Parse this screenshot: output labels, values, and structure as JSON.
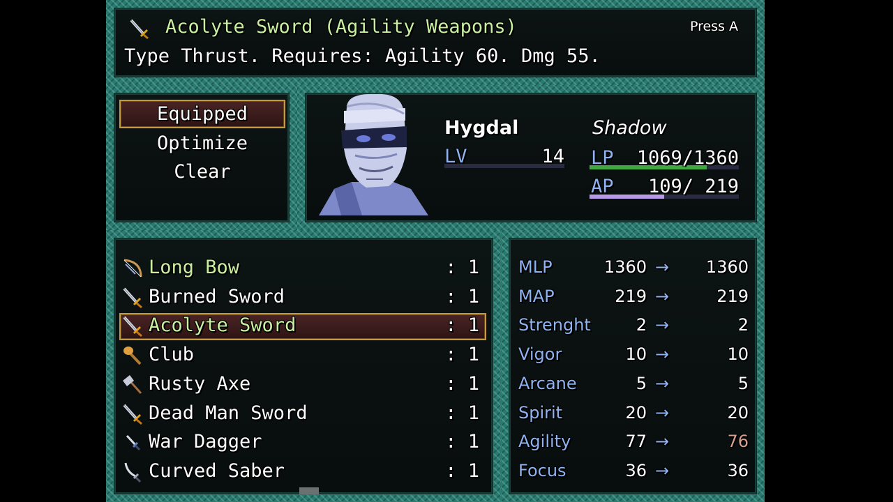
{
  "help": {
    "item_name": "Acolyte Sword (Agility Weapons)",
    "description": "Type Thrust. Requires: Agility 60. Dmg 55.",
    "press_hint": "Press A",
    "icon": "sword-icon"
  },
  "command_menu": {
    "items": [
      {
        "label": "Equipped",
        "selected": true
      },
      {
        "label": "Optimize",
        "selected": false
      },
      {
        "label": "Clear",
        "selected": false
      }
    ]
  },
  "actor": {
    "name": "Hygdal",
    "class": "Shadow",
    "level_label": "LV",
    "level": "14",
    "lp_label": "LP",
    "lp": "1069/1360",
    "lp_current": 1069,
    "lp_max": 1360,
    "ap_label": "AP",
    "ap": "109/ 219",
    "ap_current": 109,
    "ap_max": 219,
    "portrait": "bandaged-face-portrait"
  },
  "items": [
    {
      "name": "Long Bow",
      "count": ": 1",
      "icon": "bow-icon",
      "highlight": true,
      "selected": false
    },
    {
      "name": "Burned Sword",
      "count": ": 1",
      "icon": "sword-icon",
      "highlight": false,
      "selected": false
    },
    {
      "name": "Acolyte Sword",
      "count": ": 1",
      "icon": "sword-icon",
      "highlight": true,
      "selected": true
    },
    {
      "name": "Club",
      "count": ": 1",
      "icon": "club-icon",
      "highlight": false,
      "selected": false
    },
    {
      "name": "Rusty Axe",
      "count": ": 1",
      "icon": "axe-icon",
      "highlight": false,
      "selected": false
    },
    {
      "name": "Dead Man Sword",
      "count": ": 1",
      "icon": "sword-icon",
      "highlight": false,
      "selected": false
    },
    {
      "name": "War Dagger",
      "count": ": 1",
      "icon": "dagger-icon",
      "highlight": false,
      "selected": false
    },
    {
      "name": "Curved Saber",
      "count": ": 1",
      "icon": "saber-icon",
      "highlight": false,
      "selected": false
    }
  ],
  "stats": [
    {
      "label": "MLP",
      "current": "1360",
      "arrow": "→",
      "new": "1360",
      "change": "same"
    },
    {
      "label": "MAP",
      "current": "219",
      "arrow": "→",
      "new": "219",
      "change": "same"
    },
    {
      "label": "Strenght",
      "current": "2",
      "arrow": "→",
      "new": "2",
      "change": "same"
    },
    {
      "label": "Vigor",
      "current": "10",
      "arrow": "→",
      "new": "10",
      "change": "same"
    },
    {
      "label": "Arcane",
      "current": "5",
      "arrow": "→",
      "new": "5",
      "change": "same"
    },
    {
      "label": "Spirit",
      "current": "20",
      "arrow": "→",
      "new": "20",
      "change": "same"
    },
    {
      "label": "Agility",
      "current": "77",
      "arrow": "→",
      "new": "76",
      "change": "down"
    },
    {
      "label": "Focus",
      "current": "36",
      "arrow": "→",
      "new": "36",
      "change": "same"
    }
  ],
  "colors": {
    "highlight_text": "#c9f0a0",
    "system_text": "#8fb3f0",
    "decrease_text": "#d9a090",
    "lp_gauge": "#3fa83f",
    "ap_gauge": "#b89be8"
  }
}
